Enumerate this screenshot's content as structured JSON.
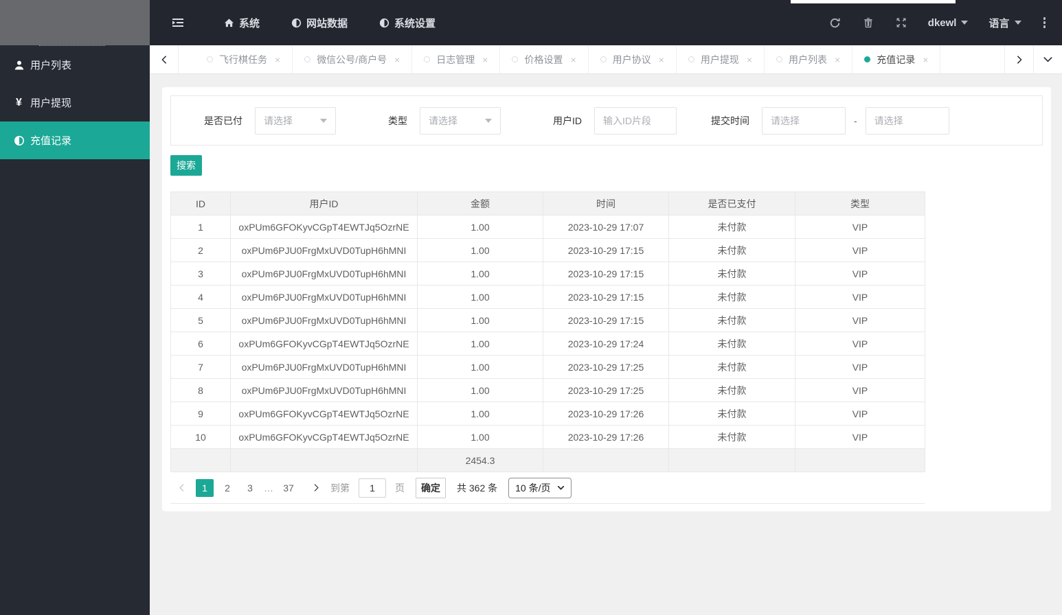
{
  "colors": {
    "accent": "#1CA896",
    "navbar_bg": "#23262E",
    "sidebar_bg": "#262A33",
    "page_bg": "#F0F0F0"
  },
  "icons": {
    "close": "×",
    "yen": "¥"
  },
  "navbar": {
    "menu": [
      {
        "label": "系统",
        "icon": "home-icon"
      },
      {
        "label": "网站数据",
        "icon": "adjust-icon"
      },
      {
        "label": "系统设置",
        "icon": "adjust-icon"
      }
    ],
    "username": "dkewl",
    "language_label": "语言"
  },
  "tabs": [
    {
      "label": "飞行棋任务",
      "active": false
    },
    {
      "label": "微信公号/商户号",
      "active": false
    },
    {
      "label": "日志管理",
      "active": false
    },
    {
      "label": "价格设置",
      "active": false
    },
    {
      "label": "用户协议",
      "active": false
    },
    {
      "label": "用户提现",
      "active": false
    },
    {
      "label": "用户列表",
      "active": false
    },
    {
      "label": "充值记录",
      "active": true
    }
  ],
  "sidebar": {
    "items": [
      {
        "label": "用户列表",
        "icon": "user-icon",
        "active": false
      },
      {
        "label": "用户提现",
        "icon": "yen-icon",
        "active": false
      },
      {
        "label": "充值记录",
        "icon": "adjust-icon",
        "active": true
      }
    ]
  },
  "filters": {
    "paid": {
      "label": "是否已付",
      "value": "请选择"
    },
    "type": {
      "label": "类型",
      "value": "请选择"
    },
    "user_id": {
      "label": "用户ID",
      "placeholder": "输入ID片段"
    },
    "submit_time": {
      "label": "提交时间",
      "start_placeholder": "请选择",
      "end_placeholder": "请选择",
      "separator": "-"
    }
  },
  "search_label": "搜索",
  "table": {
    "columns": [
      "ID",
      "用户ID",
      "金额",
      "时间",
      "是否已支付",
      "类型"
    ],
    "rows": [
      [
        "1",
        "oxPUm6GFOKyvCGpT4EWTJq5OzrNE",
        "1.00",
        "2023-10-29 17:07",
        "未付款",
        "VIP"
      ],
      [
        "2",
        "oxPUm6PJU0FrgMxUVD0TupH6hMNI",
        "1.00",
        "2023-10-29 17:15",
        "未付款",
        "VIP"
      ],
      [
        "3",
        "oxPUm6PJU0FrgMxUVD0TupH6hMNI",
        "1.00",
        "2023-10-29 17:15",
        "未付款",
        "VIP"
      ],
      [
        "4",
        "oxPUm6PJU0FrgMxUVD0TupH6hMNI",
        "1.00",
        "2023-10-29 17:15",
        "未付款",
        "VIP"
      ],
      [
        "5",
        "oxPUm6PJU0FrgMxUVD0TupH6hMNI",
        "1.00",
        "2023-10-29 17:15",
        "未付款",
        "VIP"
      ],
      [
        "6",
        "oxPUm6GFOKyvCGpT4EWTJq5OzrNE",
        "1.00",
        "2023-10-29 17:24",
        "未付款",
        "VIP"
      ],
      [
        "7",
        "oxPUm6PJU0FrgMxUVD0TupH6hMNI",
        "1.00",
        "2023-10-29 17:25",
        "未付款",
        "VIP"
      ],
      [
        "8",
        "oxPUm6PJU0FrgMxUVD0TupH6hMNI",
        "1.00",
        "2023-10-29 17:25",
        "未付款",
        "VIP"
      ],
      [
        "9",
        "oxPUm6GFOKyvCGpT4EWTJq5OzrNE",
        "1.00",
        "2023-10-29 17:26",
        "未付款",
        "VIP"
      ],
      [
        "10",
        "oxPUm6GFOKyvCGpT4EWTJq5OzrNE",
        "1.00",
        "2023-10-29 17:26",
        "未付款",
        "VIP"
      ]
    ],
    "total_amount": "2454.3"
  },
  "pagination": {
    "pages": [
      "1",
      "2",
      "3",
      "…",
      "37"
    ],
    "current": "1",
    "goto_label": "到第",
    "goto_value": "1",
    "page_unit": "页",
    "confirm_label": "确定",
    "total_label": "共 362 条",
    "page_size_label": "10 条/页"
  }
}
